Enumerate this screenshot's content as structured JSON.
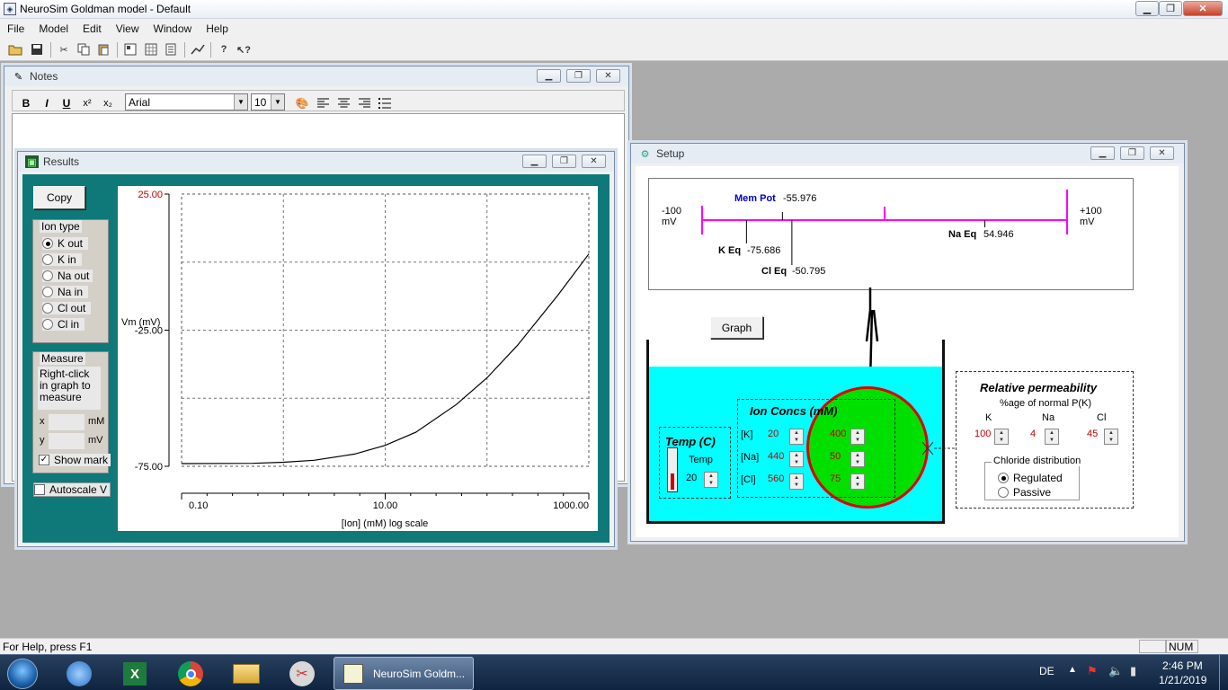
{
  "app": {
    "title": "NeuroSim Goldman model - Default",
    "icon": "neurosim-icon"
  },
  "window_controls": {
    "minimize": "▁",
    "restore": "❐",
    "close": "✕"
  },
  "menu": [
    "File",
    "Model",
    "Edit",
    "View",
    "Window",
    "Help"
  ],
  "toolbar": {
    "buttons": [
      "open-folder-icon",
      "save-icon",
      "cut-icon",
      "copy-icon",
      "paste-icon",
      "layout-icon",
      "grid-icon",
      "notes-icon",
      "graph-icon",
      "help-icon",
      "context-help-icon"
    ]
  },
  "notes": {
    "title": "Notes",
    "format": {
      "bold": "B",
      "italic": "I",
      "underline": "U",
      "superscript": "x²",
      "subscript": "x₂"
    },
    "font": "Arial",
    "size": "10"
  },
  "results": {
    "title": "Results",
    "copy": "Copy",
    "ion_type": {
      "label": "Ion type",
      "options": [
        "K out",
        "K in",
        "Na out",
        "Na in",
        "Cl out",
        "Cl in"
      ],
      "selected": 0
    },
    "measure": {
      "label": "Measure",
      "hint": "Right-click in graph to measure",
      "x": "x",
      "x_unit": "mM",
      "y": "y",
      "y_unit": "mV",
      "show_mark": "Show mark",
      "show_mark_checked": true
    },
    "autoscale": "Autoscale V",
    "autoscale_checked": false
  },
  "chart_data": {
    "type": "line",
    "title": "",
    "xlabel": "[Ion] (mM) log scale",
    "ylabel": "Vm (mV)",
    "xscale": "log",
    "xlim": [
      0.1,
      1000
    ],
    "ylim": [
      -75,
      25
    ],
    "x_tick_labels": [
      "0.10",
      "10.00",
      "1000.00"
    ],
    "y_tick_labels": [
      "25.00",
      "-25.00",
      "-75.00"
    ],
    "grid": true,
    "series": [
      {
        "x": [
          0.1,
          0.5,
          1,
          2,
          5,
          10,
          20,
          50,
          100,
          200,
          500,
          1000
        ],
        "y": [
          -74,
          -73.9,
          -73.5,
          -72.8,
          -70.5,
          -67.3,
          -62.5,
          -52.3,
          -42.5,
          -30.5,
          -12,
          3
        ]
      }
    ]
  },
  "setup": {
    "title": "Setup",
    "scale_left": "-100",
    "scale_left_unit": "mV",
    "scale_right": "+100",
    "scale_right_unit": "mV",
    "mem_pot_label": "Mem Pot",
    "mem_pot_value": "-55.976",
    "k_eq_label": "K Eq",
    "k_eq_value": "-75.686",
    "cl_eq_label": "Cl Eq",
    "cl_eq_value": "-50.795",
    "na_eq_label": "Na Eq",
    "na_eq_value": "54.946",
    "potentials_mv": {
      "mem_pot": -55.976,
      "k_eq": -75.686,
      "cl_eq": -50.795,
      "na_eq": 54.946
    },
    "graph_button": "Graph",
    "temp_title": "Temp (C)",
    "temp_label": "Temp",
    "temp_value": "20",
    "ion_concs_title": "Ion Concs  (mM)",
    "ions": [
      {
        "label": "[K]",
        "out": "20",
        "in": "400"
      },
      {
        "label": "[Na]",
        "out": "440",
        "in": "50"
      },
      {
        "label": "[Cl]",
        "out": "560",
        "in": "75"
      }
    ],
    "perm_title": "Relative permeability",
    "perm_subtitle": "%age of normal P(K)",
    "perm": [
      {
        "label": "K",
        "value": "100"
      },
      {
        "label": "Na",
        "value": "4"
      },
      {
        "label": "Cl",
        "value": "45"
      }
    ],
    "chloride_title": "Chloride distribution",
    "chloride_options": [
      "Regulated",
      "Passive"
    ],
    "chloride_selected": 0,
    "colors": {
      "bath": "#00ffff",
      "cell": "#00e000",
      "cell_border": "#e00000",
      "scale": "#ff00ff"
    }
  },
  "status": {
    "help": "For Help, press F1",
    "num": "NUM"
  },
  "taskbar": {
    "start": "start-orb",
    "pinned": [
      "thunderbird-icon",
      "excel-icon",
      "chrome-icon",
      "explorer-icon",
      "scissors-app-icon"
    ],
    "active_task": "NeuroSim Goldm...",
    "lang": "DE",
    "time": "2:46 PM",
    "date": "1/21/2019"
  }
}
